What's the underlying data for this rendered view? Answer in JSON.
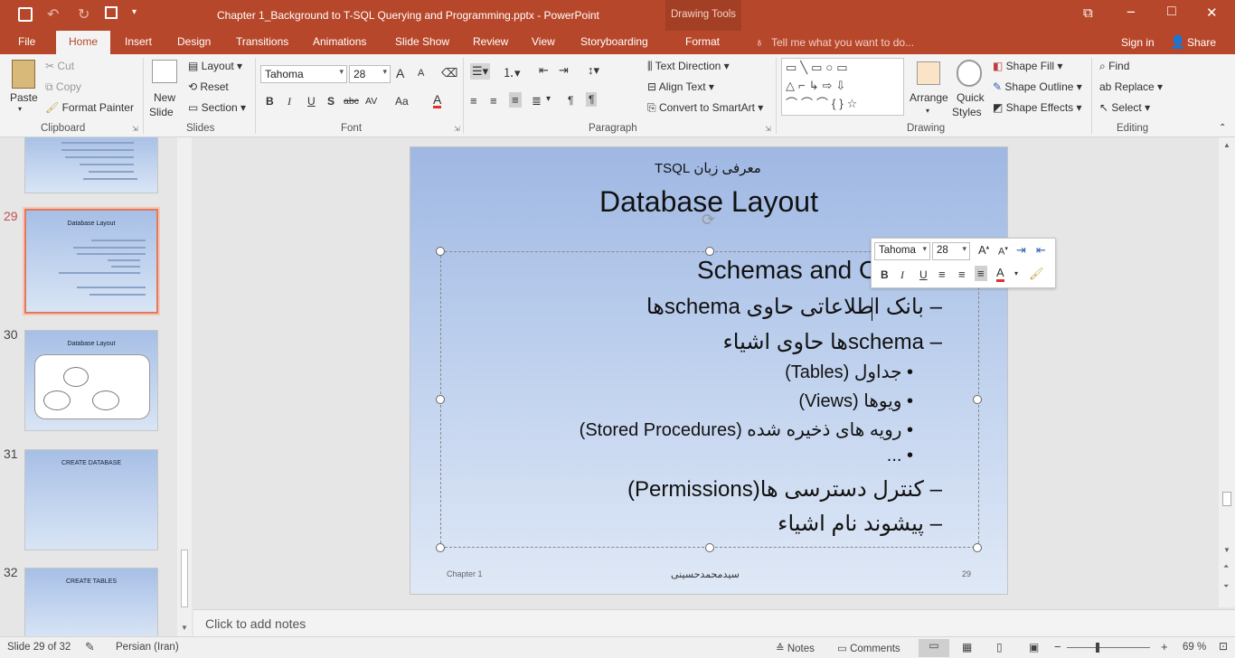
{
  "title": {
    "document": "Chapter 1_Background to T-SQL Querying and Programming.pptx - PowerPoint",
    "context_tab": "Drawing Tools",
    "restore": "⧉",
    "minimize": "−",
    "maximize": "□",
    "close": "✕"
  },
  "tabs": [
    "File",
    "Home",
    "Insert",
    "Design",
    "Transitions",
    "Animations",
    "Slide Show",
    "Review",
    "View",
    "Storyboarding",
    "Format"
  ],
  "tell_me": "Tell me what you want to do...",
  "sign_in": "Sign in",
  "share": "Share",
  "clipboard": {
    "paste": "Paste",
    "cut": "Cut",
    "copy": "Copy",
    "format_painter": "Format Painter",
    "group": "Clipboard"
  },
  "slides_grp": {
    "new_slide": "New",
    "new_slide2": "Slide",
    "layout": "Layout",
    "reset": "Reset",
    "section": "Section",
    "group": "Slides"
  },
  "font": {
    "name": "Tahoma",
    "size": "28",
    "group": "Font",
    "bold": "B",
    "italic": "I",
    "underline": "U",
    "shadow": "S",
    "strike": "abc",
    "spacing": "AV",
    "case": "Aa",
    "color": "A",
    "grow": "A",
    "shrink": "A"
  },
  "paragraph": {
    "text_direction": "Text Direction",
    "align_text": "Align Text",
    "convert_smartart": "Convert to SmartArt",
    "group": "Paragraph"
  },
  "drawing": {
    "arrange": "Arrange",
    "quick": "Quick",
    "styles": "Styles",
    "shape_fill": "Shape Fill",
    "shape_outline": "Shape Outline",
    "shape_effects": "Shape Effects",
    "group": "Drawing"
  },
  "editing": {
    "find": "Find",
    "replace": "Replace",
    "select": "Select",
    "group": "Editing"
  },
  "thumbnails": [
    {
      "num": "",
      "title": ""
    },
    {
      "num": "29",
      "title": "Database Layout"
    },
    {
      "num": "30",
      "title": "Database Layout"
    },
    {
      "num": "31",
      "title": "CREATE DATABASE"
    },
    {
      "num": "32",
      "title": "CREATE TABLES"
    }
  ],
  "slide": {
    "header": "معرفی زبان TSQL",
    "title": "Database Layout",
    "lines": [
      "Schemas and O",
      "– بانک اطلاعاتی حاوی schemaها",
      "– schemaها حاوی اشیاء",
      "• جداول (Tables)",
      "• ویوها (Views)",
      "• رویه های ذخیره شده (Stored Procedures)",
      "• ...",
      "– کنترل دسترسی ها(Permissions)",
      "– پیشوند نام اشیاء"
    ],
    "footer_left": "Chapter 1",
    "footer_center": "سیدمحمدحسینی",
    "footer_right": "29"
  },
  "mini_toolbar": {
    "font": "Tahoma",
    "size": "28"
  },
  "notes_placeholder": "Click to add notes",
  "status": {
    "slide": "Slide 29 of 32",
    "language": "Persian (Iran)",
    "notes": "Notes",
    "comments": "Comments",
    "zoom": "69 %"
  }
}
